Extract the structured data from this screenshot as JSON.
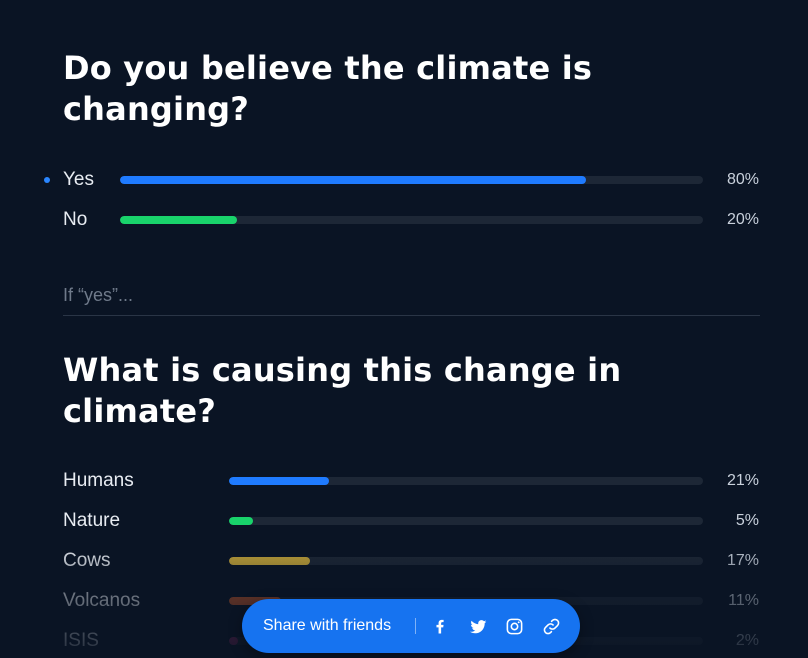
{
  "poll1": {
    "question": "Do you believe the climate is changing?",
    "options": [
      {
        "label": "Yes",
        "percent_label": "80%",
        "value": 80,
        "color": "#1f7bff",
        "selected": true
      },
      {
        "label": "No",
        "percent_label": "20%",
        "value": 20,
        "color": "#19d36b",
        "selected": false
      }
    ]
  },
  "conditional_note": "If “yes”...",
  "poll2": {
    "question": "What is causing this change in climate?",
    "options": [
      {
        "label": "Humans",
        "percent_label": "21%",
        "value": 21,
        "color": "#1f7bff"
      },
      {
        "label": "Nature",
        "percent_label": "5%",
        "value": 5,
        "color": "#19d36b"
      },
      {
        "label": "Cows",
        "percent_label": "17%",
        "value": 17,
        "color": "#c9a83a"
      },
      {
        "label": "Volcanos",
        "percent_label": "11%",
        "value": 11,
        "color": "#c2572b"
      },
      {
        "label": "ISIS",
        "percent_label": "2%",
        "value": 2,
        "color": "#a12c6e"
      }
    ]
  },
  "share_bar": {
    "label": "Share with friends",
    "icons": [
      "facebook-icon",
      "twitter-icon",
      "instagram-icon",
      "link-icon"
    ],
    "background_color": "#1673f0"
  },
  "colors": {
    "background": "#0a1424",
    "track": "#1d2736",
    "selected_dot": "#2a86ff"
  }
}
